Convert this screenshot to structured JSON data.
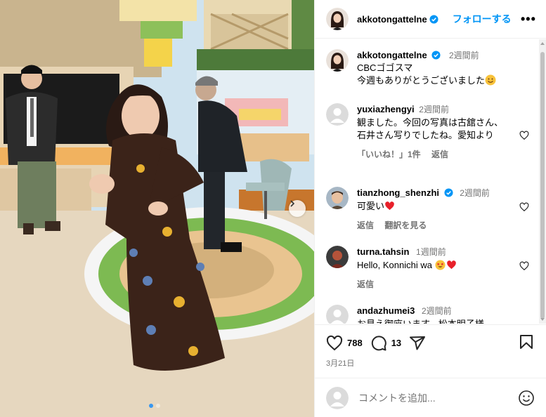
{
  "post": {
    "username": "akkotongattelne",
    "follow_label": "フォローする",
    "more_label": "•••",
    "caption": {
      "username": "akkotongattelne",
      "time": "2週間前",
      "line1": "CBCゴゴスマ",
      "line2": "今週もありがとうございました"
    },
    "likes": "788",
    "comments_count": "13",
    "date": "3月21日",
    "add_comment_placeholder": "コメントを追加...",
    "carousel": {
      "current": 1,
      "total": 2
    }
  },
  "comments": [
    {
      "username": "yuxiazhengyi",
      "time": "2週間前",
      "text": "観ました。今回の写真は古舘さん、石井さん写りでしたね。愛知より",
      "likes_label": "「いいね！」1件",
      "reply_label": "返信"
    },
    {
      "username": "tianzhong_shenzhi",
      "verified": true,
      "time": "2週間前",
      "text": "可愛い",
      "reply_label": "返信",
      "translate_label": "翻訳を見る"
    },
    {
      "username": "turna.tahsin",
      "time": "1週間前",
      "text": "Hello, Konnichi wa",
      "reply_label": "返信"
    },
    {
      "username": "andazhumei3",
      "time": "2週間前",
      "text": "お見え御座います。松本明子様"
    }
  ],
  "colors": {
    "link_blue": "#0095f6",
    "verified_blue": "#0095f6",
    "heart_red": "#ed4956",
    "muted_text": "#737373",
    "border": "#efefef"
  },
  "icons": [
    "verified-badge-icon",
    "more-icon",
    "heart-icon",
    "comment-icon",
    "share-icon",
    "bookmark-icon",
    "emoji-icon",
    "chevron-right-icon"
  ]
}
